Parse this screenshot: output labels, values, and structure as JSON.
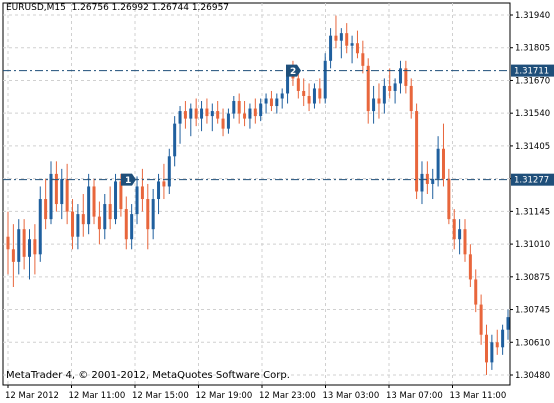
{
  "header": {
    "symbol": "EURUSD,M15",
    "ohlc": "1.26756 1.26992 1.26744 1.26957"
  },
  "footer": {
    "copyright": "MetaTrader 4, © 2001-2012, MetaQuotes Software Corp."
  },
  "colors": {
    "bull": "#1f5f9e",
    "bear": "#e8663c",
    "grid": "#d0d0d0",
    "hline": "#1f4f7a",
    "price_label_bg": "#1f4f7a"
  },
  "y_axis": {
    "ticks": [
      "1.31940",
      "1.31805",
      "1.31670",
      "1.31540",
      "1.31405",
      "1.31275",
      "1.31145",
      "1.31010",
      "1.30875",
      "1.30745",
      "1.30610",
      "1.30480"
    ]
  },
  "x_axis": {
    "ticks": [
      "12 Mar 2012",
      "12 Mar 11:00",
      "12 Mar 15:00",
      "12 Mar 19:00",
      "12 Mar 23:00",
      "13 Mar 03:00",
      "13 Mar 07:00",
      "13 Mar 11:00"
    ]
  },
  "price_lines": [
    {
      "label": "1.31711",
      "price": 1.31711
    },
    {
      "label": "1.31277",
      "price": 1.31277
    }
  ],
  "markers": [
    {
      "label": "1",
      "price": 1.31277
    },
    {
      "label": "2",
      "price": 1.31711
    }
  ],
  "chart_data": {
    "type": "candlestick",
    "symbol": "EURUSD,M15",
    "ylim": [
      1.3046,
      1.3198
    ],
    "ohlc": [
      [
        1.3105,
        1.3115,
        1.309,
        1.31
      ],
      [
        1.31,
        1.311,
        1.3085,
        1.3095
      ],
      [
        1.3095,
        1.3112,
        1.309,
        1.3108
      ],
      [
        1.3108,
        1.3112,
        1.3092,
        1.3097
      ],
      [
        1.3097,
        1.3108,
        1.3088,
        1.3104
      ],
      [
        1.3104,
        1.311,
        1.309,
        1.3098
      ],
      [
        1.3098,
        1.3125,
        1.3095,
        1.312
      ],
      [
        1.312,
        1.3128,
        1.3108,
        1.3112
      ],
      [
        1.3112,
        1.3135,
        1.311,
        1.313
      ],
      [
        1.313,
        1.3135,
        1.3115,
        1.3118
      ],
      [
        1.3118,
        1.3132,
        1.3112,
        1.3128
      ],
      [
        1.3128,
        1.3134,
        1.311,
        1.3115
      ],
      [
        1.3115,
        1.312,
        1.31,
        1.3105
      ],
      [
        1.3105,
        1.3118,
        1.31,
        1.3114
      ],
      [
        1.3114,
        1.3122,
        1.3105,
        1.311
      ],
      [
        1.311,
        1.313,
        1.3106,
        1.3125
      ],
      [
        1.3125,
        1.3128,
        1.311,
        1.3113
      ],
      [
        1.3113,
        1.3119,
        1.3102,
        1.3108
      ],
      [
        1.3108,
        1.3122,
        1.3104,
        1.3118
      ],
      [
        1.3118,
        1.3125,
        1.3108,
        1.3112
      ],
      [
        1.3112,
        1.313,
        1.311,
        1.3127
      ],
      [
        1.3127,
        1.313,
        1.3113,
        1.3116
      ],
      [
        1.3116,
        1.3121,
        1.31,
        1.3104
      ],
      [
        1.3104,
        1.3118,
        1.31,
        1.3114
      ],
      [
        1.3114,
        1.3129,
        1.311,
        1.3125
      ],
      [
        1.3125,
        1.3132,
        1.3115,
        1.312
      ],
      [
        1.312,
        1.3126,
        1.31,
        1.3108
      ],
      [
        1.3108,
        1.3124,
        1.3104,
        1.312
      ],
      [
        1.312,
        1.313,
        1.3114,
        1.3127
      ],
      [
        1.3127,
        1.3134,
        1.312,
        1.3125
      ],
      [
        1.3125,
        1.314,
        1.3122,
        1.3137
      ],
      [
        1.3137,
        1.3153,
        1.3133,
        1.315
      ],
      [
        1.315,
        1.3157,
        1.3142,
        1.3155
      ],
      [
        1.3155,
        1.3159,
        1.3148,
        1.3152
      ],
      [
        1.3152,
        1.3158,
        1.3145,
        1.3156
      ],
      [
        1.3156,
        1.316,
        1.3149,
        1.3152
      ],
      [
        1.3152,
        1.3159,
        1.3147,
        1.3156
      ],
      [
        1.3156,
        1.316,
        1.315,
        1.3153
      ],
      [
        1.3153,
        1.3158,
        1.3147,
        1.3155
      ],
      [
        1.3155,
        1.3159,
        1.315,
        1.3152
      ],
      [
        1.3152,
        1.3156,
        1.3145,
        1.3148
      ],
      [
        1.3148,
        1.3156,
        1.3146,
        1.3154
      ],
      [
        1.3154,
        1.3161,
        1.3152,
        1.3159
      ],
      [
        1.3159,
        1.3162,
        1.315,
        1.3154
      ],
      [
        1.3154,
        1.3159,
        1.3149,
        1.3152
      ],
      [
        1.3152,
        1.3158,
        1.3148,
        1.3156
      ],
      [
        1.3156,
        1.316,
        1.315,
        1.3153
      ],
      [
        1.3153,
        1.316,
        1.3151,
        1.3158
      ],
      [
        1.3158,
        1.3162,
        1.3154,
        1.316
      ],
      [
        1.316,
        1.3163,
        1.3155,
        1.3157
      ],
      [
        1.3157,
        1.3162,
        1.3154,
        1.316
      ],
      [
        1.316,
        1.3164,
        1.3156,
        1.3162
      ],
      [
        1.3162,
        1.3172,
        1.3158,
        1.317
      ],
      [
        1.317,
        1.3175,
        1.3165,
        1.3168
      ],
      [
        1.3168,
        1.3172,
        1.316,
        1.3163
      ],
      [
        1.3163,
        1.3168,
        1.3157,
        1.3161
      ],
      [
        1.3161,
        1.3166,
        1.3155,
        1.3158
      ],
      [
        1.3158,
        1.3166,
        1.3156,
        1.3164
      ],
      [
        1.3164,
        1.3168,
        1.3158,
        1.316
      ],
      [
        1.316,
        1.3178,
        1.3158,
        1.3175
      ],
      [
        1.3175,
        1.3188,
        1.3172,
        1.3185
      ],
      [
        1.3185,
        1.3193,
        1.318,
        1.3183
      ],
      [
        1.3183,
        1.3188,
        1.3176,
        1.3186
      ],
      [
        1.3186,
        1.319,
        1.3178,
        1.3181
      ],
      [
        1.3181,
        1.3185,
        1.3174,
        1.3182
      ],
      [
        1.3182,
        1.3187,
        1.3176,
        1.3178
      ],
      [
        1.3178,
        1.3183,
        1.317,
        1.3173
      ],
      [
        1.3173,
        1.3176,
        1.315,
        1.3155
      ],
      [
        1.3155,
        1.3165,
        1.315,
        1.316
      ],
      [
        1.316,
        1.3166,
        1.3152,
        1.3158
      ],
      [
        1.3158,
        1.3168,
        1.3154,
        1.3165
      ],
      [
        1.3165,
        1.3172,
        1.316,
        1.3163
      ],
      [
        1.3163,
        1.3168,
        1.3158,
        1.3166
      ],
      [
        1.3166,
        1.3175,
        1.3162,
        1.3172
      ],
      [
        1.3172,
        1.3175,
        1.3162,
        1.3165
      ],
      [
        1.3165,
        1.3168,
        1.3152,
        1.3155
      ],
      [
        1.3155,
        1.3158,
        1.312,
        1.3123
      ],
      [
        1.3123,
        1.3135,
        1.3118,
        1.313
      ],
      [
        1.313,
        1.3135,
        1.3122,
        1.3126
      ],
      [
        1.3126,
        1.3132,
        1.312,
        1.3128
      ],
      [
        1.3128,
        1.3145,
        1.3125,
        1.314
      ],
      [
        1.314,
        1.315,
        1.3125,
        1.3128
      ],
      [
        1.3128,
        1.3132,
        1.311,
        1.3112
      ],
      [
        1.3112,
        1.3116,
        1.31,
        1.3104
      ],
      [
        1.3104,
        1.3112,
        1.3098,
        1.3108
      ],
      [
        1.3108,
        1.3112,
        1.3095,
        1.3098
      ],
      [
        1.3098,
        1.3102,
        1.3085,
        1.3088
      ],
      [
        1.3088,
        1.3092,
        1.3075,
        1.3078
      ],
      [
        1.3078,
        1.3082,
        1.3062,
        1.3066
      ],
      [
        1.3066,
        1.307,
        1.305,
        1.3055
      ],
      [
        1.3055,
        1.3066,
        1.3052,
        1.3063
      ],
      [
        1.3063,
        1.3068,
        1.3058,
        1.3061
      ],
      [
        1.3061,
        1.307,
        1.3058,
        1.3068
      ],
      [
        1.3068,
        1.3076,
        1.3064,
        1.3073
      ]
    ]
  }
}
